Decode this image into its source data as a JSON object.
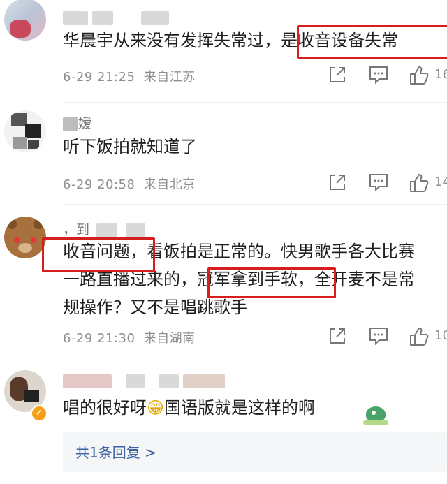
{
  "comments": [
    {
      "text": "华晨宇从来没有发挥失常过，是收音设备失常",
      "date": "6-29 21:25",
      "source": "来自江苏",
      "likes": "16"
    },
    {
      "username": "嫒",
      "text": "听下饭拍就知道了",
      "date": "6-29 20:58",
      "source": "来自北京",
      "likes": "14"
    },
    {
      "username": "，到",
      "line1": "收音问题，看饭拍是正常的。快男歌手各大比赛",
      "line2": "一路直播过来的，冠军拿到手软，全开麦不是常",
      "line3": "规操作？又不是唱跳歌手",
      "date": "6-29 21:30",
      "source": "来自湖南",
      "likes": "10"
    },
    {
      "text_before": "唱的很好呀",
      "emoji": "😁",
      "text_after": "国语版就是这样的啊"
    }
  ],
  "reply": {
    "label": "共1条回复 >"
  },
  "colors": {
    "highlight": "#d61e1e",
    "link": "#3a63a3",
    "meta": "#8f8f8f"
  },
  "icons": [
    "share-icon",
    "comment-icon",
    "like-icon"
  ]
}
